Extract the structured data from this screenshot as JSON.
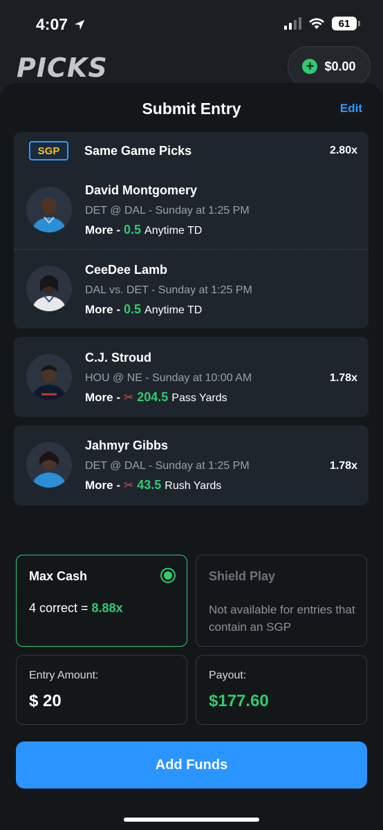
{
  "status_bar": {
    "time": "4:07",
    "battery": "61"
  },
  "header": {
    "logo": "PICKS",
    "balance": "$0.00"
  },
  "sheet": {
    "title": "Submit Entry",
    "edit_label": "Edit"
  },
  "sgp_group": {
    "badge": "SGP",
    "title": "Same Game Picks",
    "multiplier": "2.80x",
    "picks": [
      {
        "name": "David Montgomery",
        "game": "DET @ DAL  - Sunday at 1:25 PM",
        "direction": "More -",
        "value": "0.5",
        "stat": "Anytime TD",
        "jersey_color": "#2a8fd6"
      },
      {
        "name": "CeeDee Lamb",
        "game": "DAL vs. DET  - Sunday at 1:25 PM",
        "direction": "More -",
        "value": "0.5",
        "stat": "Anytime TD",
        "jersey_color": "#e8e8e8"
      }
    ]
  },
  "single_picks": [
    {
      "name": "C.J. Stroud",
      "game": "HOU @ NE  - Sunday at 10:00 AM",
      "direction": "More -",
      "scissors": "✂",
      "value": "204.5",
      "stat": "Pass Yards",
      "multiplier": "1.78x",
      "jersey_color": "#0e1a2b"
    },
    {
      "name": "Jahmyr Gibbs",
      "game": "DET @ DAL  - Sunday at 1:25 PM",
      "direction": "More -",
      "scissors": "✂",
      "value": "43.5",
      "stat": "Rush Yards",
      "multiplier": "1.78x",
      "jersey_color": "#2a8fd6"
    }
  ],
  "play_types": {
    "max_cash": {
      "title": "Max Cash",
      "result_prefix": "4 correct = ",
      "result_value": "8.88x",
      "selected": true
    },
    "shield_play": {
      "title": "Shield Play",
      "note": "Not available for entries that contain an SGP"
    }
  },
  "entry": {
    "amount_label": "Entry Amount:",
    "amount": "$ 20",
    "payout_label": "Payout:",
    "payout": "$177.60"
  },
  "cta": {
    "label": "Add Funds"
  },
  "colors": {
    "accent_blue": "#2b95ff",
    "accent_green": "#2ecc71",
    "sgp_yellow": "#f1c40f"
  }
}
